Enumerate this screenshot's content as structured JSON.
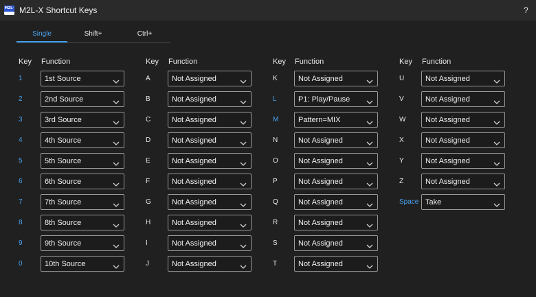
{
  "window": {
    "title": "M2L-X Shortcut Keys",
    "help_label": "?",
    "icon_label": "M2L-X"
  },
  "tabs": [
    {
      "label": "Single",
      "active": true
    },
    {
      "label": "Shift+",
      "active": false
    },
    {
      "label": "Ctrl+",
      "active": false
    }
  ],
  "headers": {
    "key": "Key",
    "function": "Function"
  },
  "accent_color": "#4aa3f0",
  "columns": [
    {
      "rows": [
        {
          "key": "1",
          "value": "1st Source",
          "highlight": true
        },
        {
          "key": "2",
          "value": "2nd Source",
          "highlight": true
        },
        {
          "key": "3",
          "value": "3rd Source",
          "highlight": true
        },
        {
          "key": "4",
          "value": "4th Source",
          "highlight": true
        },
        {
          "key": "5",
          "value": "5th Source",
          "highlight": true
        },
        {
          "key": "6",
          "value": "6th Source",
          "highlight": true
        },
        {
          "key": "7",
          "value": "7th Source",
          "highlight": true
        },
        {
          "key": "8",
          "value": "8th Source",
          "highlight": true
        },
        {
          "key": "9",
          "value": "9th Source",
          "highlight": true
        },
        {
          "key": "0",
          "value": "10th Source",
          "highlight": true
        }
      ]
    },
    {
      "rows": [
        {
          "key": "A",
          "value": "Not Assigned",
          "highlight": false
        },
        {
          "key": "B",
          "value": "Not Assigned",
          "highlight": false
        },
        {
          "key": "C",
          "value": "Not Assigned",
          "highlight": false
        },
        {
          "key": "D",
          "value": "Not Assigned",
          "highlight": false
        },
        {
          "key": "E",
          "value": "Not Assigned",
          "highlight": false
        },
        {
          "key": "F",
          "value": "Not Assigned",
          "highlight": false
        },
        {
          "key": "G",
          "value": "Not Assigned",
          "highlight": false
        },
        {
          "key": "H",
          "value": "Not Assigned",
          "highlight": false
        },
        {
          "key": "I",
          "value": "Not Assigned",
          "highlight": false
        },
        {
          "key": "J",
          "value": "Not Assigned",
          "highlight": false
        }
      ]
    },
    {
      "rows": [
        {
          "key": "K",
          "value": "Not Assigned",
          "highlight": false
        },
        {
          "key": "L",
          "value": "P1: Play/Pause",
          "highlight": true
        },
        {
          "key": "M",
          "value": "Pattern=MIX",
          "highlight": true
        },
        {
          "key": "N",
          "value": "Not Assigned",
          "highlight": false
        },
        {
          "key": "O",
          "value": "Not Assigned",
          "highlight": false
        },
        {
          "key": "P",
          "value": "Not Assigned",
          "highlight": false
        },
        {
          "key": "Q",
          "value": "Not Assigned",
          "highlight": false
        },
        {
          "key": "R",
          "value": "Not Assigned",
          "highlight": false
        },
        {
          "key": "S",
          "value": "Not Assigned",
          "highlight": false
        },
        {
          "key": "T",
          "value": "Not Assigned",
          "highlight": false
        }
      ]
    },
    {
      "rows": [
        {
          "key": "U",
          "value": "Not Assigned",
          "highlight": false
        },
        {
          "key": "V",
          "value": "Not Assigned",
          "highlight": false
        },
        {
          "key": "W",
          "value": "Not Assigned",
          "highlight": false
        },
        {
          "key": "X",
          "value": "Not Assigned",
          "highlight": false
        },
        {
          "key": "Y",
          "value": "Not Assigned",
          "highlight": false
        },
        {
          "key": "Z",
          "value": "Not Assigned",
          "highlight": false
        },
        {
          "key": "Space",
          "value": "Take",
          "highlight": true
        }
      ]
    }
  ]
}
